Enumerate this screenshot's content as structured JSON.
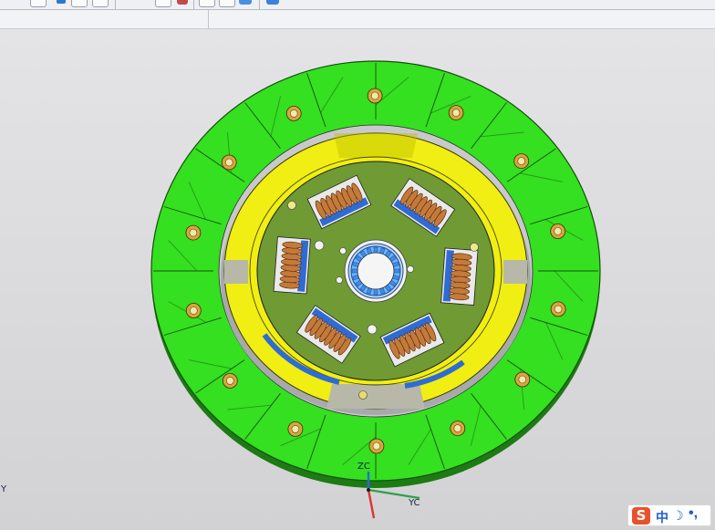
{
  "toolbar": {
    "icons": [
      "select-filter-icon",
      "point-snap-icon",
      "line-tool-icon",
      "arc-tool-icon",
      "undo-arc-icon",
      "insert-icon",
      "circle-view-icon",
      "shaded-view-icon",
      "section-icon",
      "edit-icon",
      "view-triad-icon",
      "cube-view-icon"
    ]
  },
  "viewport": {
    "axes": {
      "zc": "ZC",
      "yc": "YC",
      "y_edge": "Y"
    },
    "colors": {
      "friction_ring": "#34e01f",
      "friction_edge": "#1e7a14",
      "retainer_ring": "#f1ee13",
      "hub_plate": "#6f9a34",
      "spring": "#c57a3a",
      "spline_hub": "#6cb6ff",
      "background": "#dcdcde"
    },
    "rivets": 14,
    "damper_springs": 6
  },
  "ime": {
    "lang": "中",
    "moon": "☽",
    "punct": "•,"
  }
}
